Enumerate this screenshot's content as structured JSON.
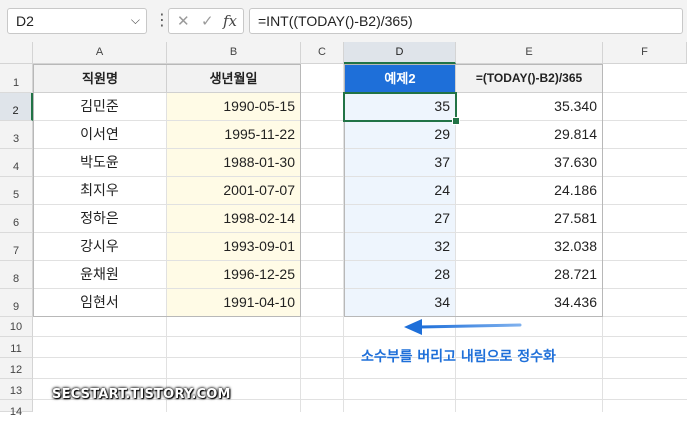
{
  "formula_bar": {
    "name_box": "D2",
    "formula": "=INT((TODAY()-B2)/365)"
  },
  "columns": [
    "A",
    "B",
    "C",
    "D",
    "E",
    "F"
  ],
  "rows": [
    "1",
    "2",
    "3",
    "4",
    "5",
    "6",
    "7",
    "8",
    "9",
    "10",
    "11",
    "12",
    "13",
    "14"
  ],
  "table": {
    "headers": {
      "a": "직원명",
      "b": "생년월일",
      "d": "예제2",
      "e": "=(TODAY()-B2)/365"
    },
    "data": [
      {
        "name": "김민준",
        "birth": "1990-05-15",
        "d": "35",
        "e": "35.340"
      },
      {
        "name": "이서연",
        "birth": "1995-11-22",
        "d": "29",
        "e": "29.814"
      },
      {
        "name": "박도윤",
        "birth": "1988-01-30",
        "d": "37",
        "e": "37.630"
      },
      {
        "name": "최지우",
        "birth": "2001-07-07",
        "d": "24",
        "e": "24.186"
      },
      {
        "name": "정하은",
        "birth": "1998-02-14",
        "d": "27",
        "e": "27.581"
      },
      {
        "name": "강시우",
        "birth": "1993-09-01",
        "d": "32",
        "e": "32.038"
      },
      {
        "name": "윤채원",
        "birth": "1996-12-25",
        "d": "28",
        "e": "28.721"
      },
      {
        "name": "임현서",
        "birth": "1991-04-10",
        "d": "34",
        "e": "34.436"
      }
    ]
  },
  "annotation": {
    "text": "소수부를 버리고 내림으로 정수화"
  },
  "watermark": "SECSTART.TISTORY.COM",
  "colors": {
    "accent_blue": "#1e6fd9",
    "selection_green": "#217346",
    "birth_fill": "#fffbe6",
    "result_fill": "#eef5fd"
  }
}
